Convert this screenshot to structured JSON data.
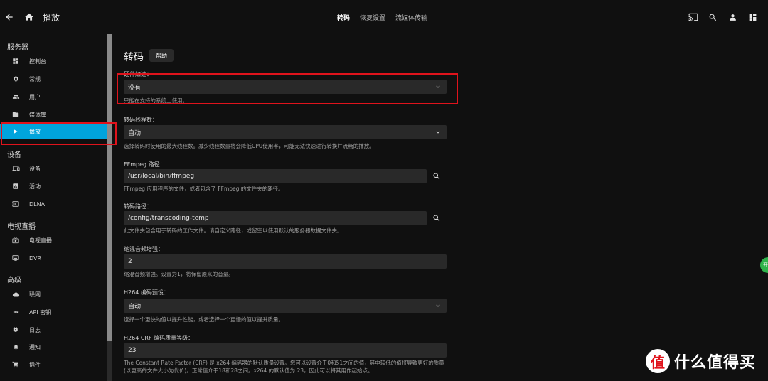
{
  "header": {
    "title": "播放",
    "tabs": [
      "转码",
      "恢复设置",
      "流媒体传输"
    ],
    "active_tab": 0,
    "icons": [
      "back-arrow-icon",
      "home-icon",
      "cast-icon",
      "search-icon",
      "user-icon",
      "dashboard-icon"
    ]
  },
  "sidebar": {
    "sections": [
      {
        "title": "服务器",
        "items": [
          {
            "label": "控制台",
            "icon": "dashboard-icon"
          },
          {
            "label": "常规",
            "icon": "gear-icon"
          },
          {
            "label": "用户",
            "icon": "people-icon"
          },
          {
            "label": "媒体库",
            "icon": "folder-icon"
          },
          {
            "label": "播放",
            "icon": "play-icon",
            "active": true
          }
        ]
      },
      {
        "title": "设备",
        "items": [
          {
            "label": "设备",
            "icon": "devices-icon"
          },
          {
            "label": "活动",
            "icon": "activity-icon"
          },
          {
            "label": "DLNA",
            "icon": "input-icon"
          }
        ]
      },
      {
        "title": "电视直播",
        "items": [
          {
            "label": "电视直播",
            "icon": "live-tv-icon"
          },
          {
            "label": "DVR",
            "icon": "dvr-icon"
          }
        ]
      },
      {
        "title": "高级",
        "items": [
          {
            "label": "联网",
            "icon": "cloud-icon"
          },
          {
            "label": "API 密钥",
            "icon": "key-icon"
          },
          {
            "label": "日志",
            "icon": "bug-icon"
          },
          {
            "label": "通知",
            "icon": "bell-icon"
          },
          {
            "label": "插件",
            "icon": "cart-icon"
          }
        ]
      }
    ]
  },
  "main": {
    "title": "转码",
    "help_label": "帮助",
    "hw_accel": {
      "label": "硬件加速：",
      "value": "没有",
      "desc": "只能在支持的系统上使用。"
    },
    "threads": {
      "label": "转码线程数：",
      "value": "自动",
      "desc": "选择转码时使用的最大线程数。减少线程数量将会降低CPU使用率，可能无法快速进行转换并流畅的播放。"
    },
    "ffmpeg_path": {
      "label": "FFmpeg 路径：",
      "value": "/usr/local/bin/ffmpeg",
      "desc": "FFmpeg 应用程序的文件，或者包含了 FFmpeg 的文件夹的路径。"
    },
    "transcode_path": {
      "label": "转码路径：",
      "value": "/config/transcoding-temp",
      "desc": "此文件夹包含用于转码的工作文件。请自定义路径，或留空以使用默认的服务器数据文件夹。"
    },
    "downmix": {
      "label": "缩混音频增强：",
      "value": "2",
      "desc": "缩混音频增强。设置为1，将保留原来的音量。"
    },
    "h264_preset": {
      "label": "H264 编码预设：",
      "value": "自动",
      "desc": "选择一个更快的值以提升性能，或者选择一个更慢的值以提升质量。"
    },
    "h264_crf": {
      "label": "H264 CRF 编码质量等级：",
      "value": "23",
      "desc": "The Constant Rate Factor (CRF) 是 x264 编码器的默认质量设置。您可以设置介于0和51之间的值，其中较低的值将导致更好的质量 (以更高的文件大小为代价)。正常值介于18和28之间。x264 的默认值为 23，因此可以将其用作起始点。"
    }
  },
  "watermark": {
    "text": "什么值得买",
    "badge": "值"
  },
  "side_badge": "开",
  "colors": {
    "accent": "#00a4dc",
    "highlight": "#e0131c",
    "background": "#101010",
    "field": "#292929"
  }
}
